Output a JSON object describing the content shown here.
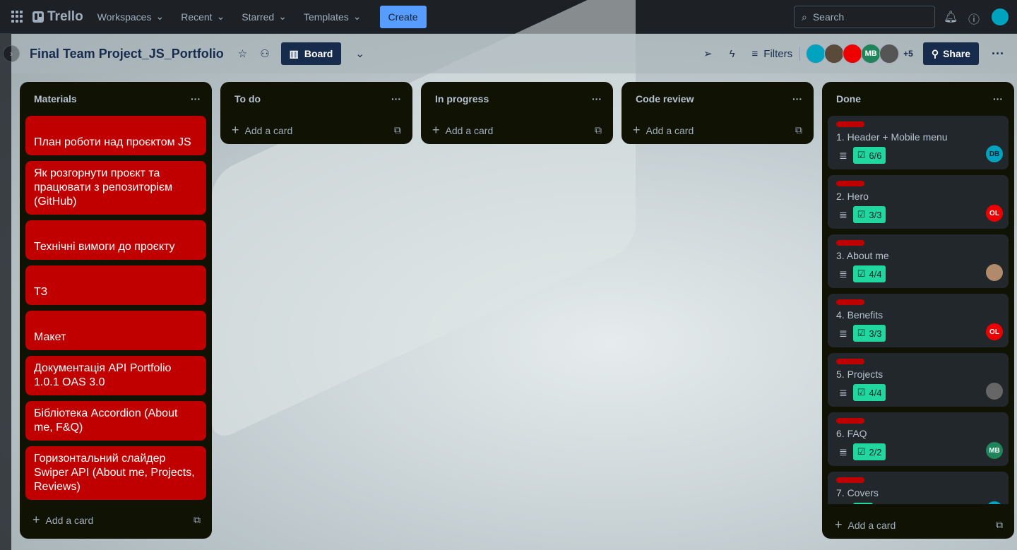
{
  "topbar": {
    "app": "Trello",
    "nav": [
      "Workspaces",
      "Recent",
      "Starred",
      "Templates"
    ],
    "create": "Create",
    "search_placeholder": "Search"
  },
  "board": {
    "title": "Final Team Project_JS_Portfolio",
    "view": "Board",
    "filters": "Filters",
    "extra_members": "+5",
    "share": "Share",
    "members": [
      {
        "initials": "",
        "color": "#00a3bf"
      },
      {
        "initials": "",
        "color": "#5a4a3a"
      },
      {
        "initials": "",
        "color": "#e00"
      },
      {
        "initials": "MB",
        "color": "#1f845a"
      },
      {
        "initials": "",
        "color": "#555"
      }
    ]
  },
  "add_card": "Add a card",
  "lists": [
    {
      "title": "Materials",
      "cards": [
        "План роботи над проєктом JS",
        "Як розгорнути проєкт та працювати з репозиторієм (GitHub)",
        "Технічні вимоги до проєкту",
        "ТЗ",
        "Макет",
        "Документація API Portfolio 1.0.1 OAS 3.0",
        "Бібліотека Accordion (About me, F&Q)",
        "Горизонтальний слайдер Swiper API (About me, Projects, Reviews)"
      ]
    },
    {
      "title": "To do"
    },
    {
      "title": "In progress"
    },
    {
      "title": "Code review"
    },
    {
      "title": "Done",
      "cards": [
        {
          "title": "1. Header + Mobile menu",
          "checklist": "6/6",
          "member": "DB",
          "member_color": "#00a3bf"
        },
        {
          "title": "2. Hero",
          "checklist": "3/3",
          "member": "OL",
          "member_color": "#e00"
        },
        {
          "title": "3. About me",
          "checklist": "4/4",
          "member": "",
          "member_color": "#b08a6a"
        },
        {
          "title": "4. Benefits",
          "checklist": "3/3",
          "member": "OL",
          "member_color": "#e00"
        },
        {
          "title": "5. Projects",
          "checklist": "4/4",
          "member": "",
          "member_color": "#666"
        },
        {
          "title": "6. FAQ",
          "checklist": "2/2",
          "member": "MB",
          "member_color": "#1f845a"
        },
        {
          "title": "7. Covers",
          "checklist": "",
          "member": "",
          "member_color": "#00a3bf"
        }
      ]
    }
  ]
}
